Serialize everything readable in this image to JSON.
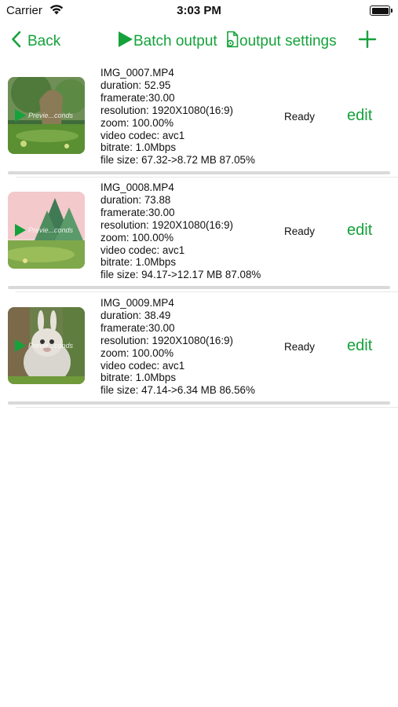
{
  "status_bar": {
    "carrier": "Carrier",
    "time": "3:03 PM",
    "wifi_icon": "wifi-icon",
    "battery_icon": "battery-icon"
  },
  "nav": {
    "back_label": "Back",
    "batch_label": "Batch output",
    "settings_label": "output settings",
    "add_icon": "plus-icon",
    "accent_color": "#15a23b"
  },
  "videos": [
    {
      "filename": "IMG_0007.MP4",
      "duration": "duration: 52.95",
      "framerate": "framerate:30.00",
      "resolution": "resolution: 1920X1080(16:9)",
      "zoom": "zoom: 100.00%",
      "codec": "video codec: avc1",
      "bitrate": "bitrate: 1.0Mbps",
      "filesize": "file size: 67.32->8.72 MB 87.05%",
      "status": "Ready",
      "edit": "edit",
      "preview": "Previe...conds",
      "progress": 0
    },
    {
      "filename": "IMG_0008.MP4",
      "duration": "duration: 73.88",
      "framerate": "framerate:30.00",
      "resolution": "resolution: 1920X1080(16:9)",
      "zoom": "zoom: 100.00%",
      "codec": "video codec: avc1",
      "bitrate": "bitrate: 1.0Mbps",
      "filesize": "file size: 94.17->12.17 MB 87.08%",
      "status": "Ready",
      "edit": "edit",
      "preview": "Previe...conds",
      "progress": 0
    },
    {
      "filename": "IMG_0009.MP4",
      "duration": "duration: 38.49",
      "framerate": "framerate:30.00",
      "resolution": "resolution: 1920X1080(16:9)",
      "zoom": "zoom: 100.00%",
      "codec": "video codec: avc1",
      "bitrate": "bitrate: 1.0Mbps",
      "filesize": "file size: 47.14->6.34 MB 86.56%",
      "status": "Ready",
      "edit": "edit",
      "preview": "Previe...conds",
      "progress": 0
    }
  ]
}
